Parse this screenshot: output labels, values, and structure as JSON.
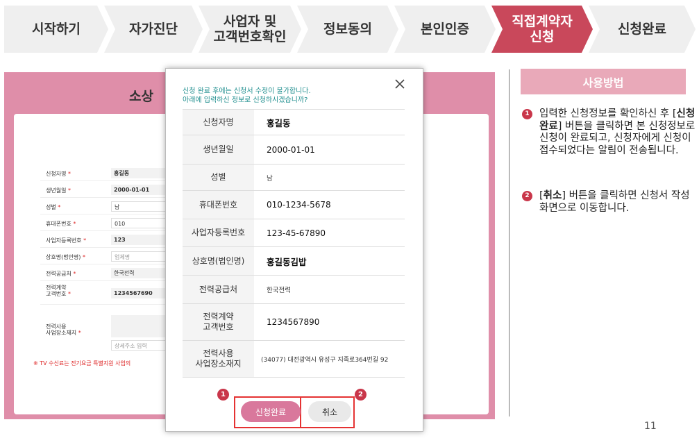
{
  "steps": [
    {
      "label": "시작하기"
    },
    {
      "label": "자가진단"
    },
    {
      "label": "사업자 및\n고객번호확인"
    },
    {
      "label": "정보동의"
    },
    {
      "label": "본인인증"
    },
    {
      "label": "직접계약자\n신청",
      "active": true
    },
    {
      "label": "신청완료"
    }
  ],
  "background_form": {
    "title": "소상",
    "rows": [
      {
        "label": "신청자명",
        "value": "홍길동"
      },
      {
        "label": "생년월일",
        "value": "2000-01-01"
      },
      {
        "label": "성별",
        "value": "남"
      },
      {
        "label": "휴대폰번호",
        "value": "010"
      },
      {
        "label": "사업자등록번호",
        "value": "123"
      },
      {
        "label": "상호명(법인명)",
        "value": "업체명"
      },
      {
        "label": "전력공급처",
        "value": "한국전력"
      },
      {
        "label": "전력계약\n고객번호",
        "value": "1234567690"
      },
      {
        "label": "전력사용\n사업장소재지",
        "value": "상세주소 입력"
      }
    ],
    "required_mark": "*",
    "note": "※ TV 수신료는 전기요금 특별지원 사업의"
  },
  "modal": {
    "message_line1": "신청 완료 후에는 신청서 수정이 불가합니다.",
    "message_line2": "아래에 입력하신 정보로 신청하시겠습니까?",
    "close_symbol": "×",
    "rows": [
      {
        "label": "신청자명",
        "value": "홍길동"
      },
      {
        "label": "생년월일",
        "value": "2000-01-01"
      },
      {
        "label": "성별",
        "value": "남"
      },
      {
        "label": "휴대폰번호",
        "value": "010-1234-5678"
      },
      {
        "label": "사업자등록번호",
        "value": "123-45-67890"
      },
      {
        "label": "상호명(법인명)",
        "value": "홍길동김밥"
      },
      {
        "label": "전력공급처",
        "value": "한국전력"
      },
      {
        "label": "전력계약\n고객번호",
        "value": "1234567890"
      },
      {
        "label": "전력사용\n사업장소재지",
        "value": "(34077) 대전광역시 유성구 지족로364번길 92"
      }
    ],
    "submit_label": "신청완료",
    "cancel_label": "취소",
    "marker1": "1",
    "marker2": "2"
  },
  "guide": {
    "title": "사용방법",
    "item1": {
      "num": "1",
      "pre": "입력한 신청정보를 확인하신 후 [",
      "bold": "신청완료",
      "post": "] 버튼을 클릭하면 본 신청정보로 신청이 완료되고, 신청자에게 신청이 접수되었다는 알림이 전송됩니다."
    },
    "item2": {
      "num": "2",
      "pre": "[",
      "bold": "취소",
      "post": "] 버튼을 클릭하면 신청서 작성 화면으로 이동합니다."
    }
  },
  "page_number": "11",
  "colors": {
    "accent": "#c9485b",
    "pink": "#d9789c",
    "highlight": "#e53232"
  }
}
